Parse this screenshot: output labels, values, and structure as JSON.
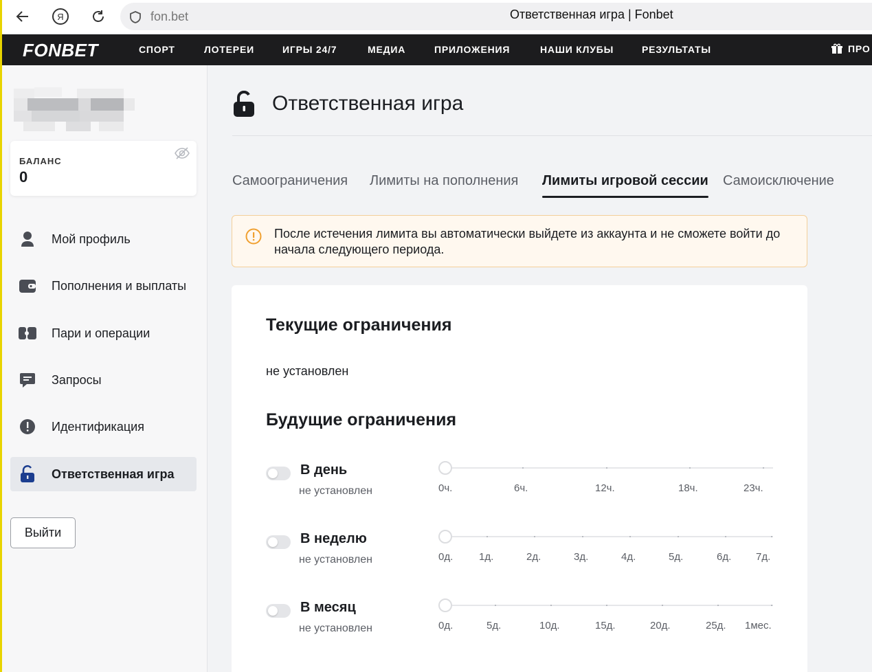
{
  "browser": {
    "url": "fon.bet",
    "tab_title": "Ответственная игра | Fonbet"
  },
  "topnav": {
    "logo": "FONBET",
    "items": [
      "СПОРТ",
      "ЛОТЕРЕИ",
      "ИГРЫ 24/7",
      "МЕДИА",
      "ПРИЛОЖЕНИЯ",
      "НАШИ КЛУБЫ",
      "РЕЗУЛЬТАТЫ"
    ],
    "gift_label": "ПРО"
  },
  "sidebar": {
    "balance_label": "БАЛАНС",
    "balance_value": "0",
    "items": [
      {
        "label": "Мой профиль",
        "icon": "user-icon"
      },
      {
        "label": "Пополнения и выплаты",
        "icon": "wallet-icon"
      },
      {
        "label": "Пари и операции",
        "icon": "tickets-icon"
      },
      {
        "label": "Запросы",
        "icon": "chat-icon"
      },
      {
        "label": "Идентификация",
        "icon": "exclamation-icon"
      },
      {
        "label": "Ответственная игра",
        "icon": "lock-icon"
      }
    ],
    "active_index": 5,
    "logout_label": "Выйти"
  },
  "page": {
    "title": "Ответственная игра",
    "tabs": [
      "Самоограничения",
      "Лимиты на пополнения",
      "Лимиты игровой сессии",
      "Самоисключение"
    ],
    "active_tab": 2,
    "notice": "После истечения лимита вы автоматически выйдете из аккаунта и не сможете войти до начала следующего периода.",
    "current_heading": "Текущие ограничения",
    "current_value": "не установлен",
    "future_heading": "Будущие ограничения",
    "limits": [
      {
        "title": "В день",
        "status": "не установлен",
        "enabled": false,
        "ticks": [
          "0ч.",
          "6ч.",
          "12ч.",
          "18ч.",
          "23ч."
        ]
      },
      {
        "title": "В неделю",
        "status": "не установлен",
        "enabled": false,
        "ticks": [
          "0д.",
          "1д.",
          "2д.",
          "3д.",
          "4д.",
          "5д.",
          "6д.",
          "7д."
        ]
      },
      {
        "title": "В месяц",
        "status": "не установлен",
        "enabled": false,
        "ticks": [
          "0д.",
          "5д.",
          "10д.",
          "15д.",
          "20д.",
          "25д.",
          "1мес."
        ]
      }
    ]
  },
  "colors": {
    "nav_bg": "#1c1c1e",
    "accent_yellow": "#e8d400",
    "notice_bg": "#fff8ef",
    "notice_border": "#f4cf99",
    "warning_orange": "#f0a030",
    "active_lock_blue": "#1b3d8f"
  }
}
